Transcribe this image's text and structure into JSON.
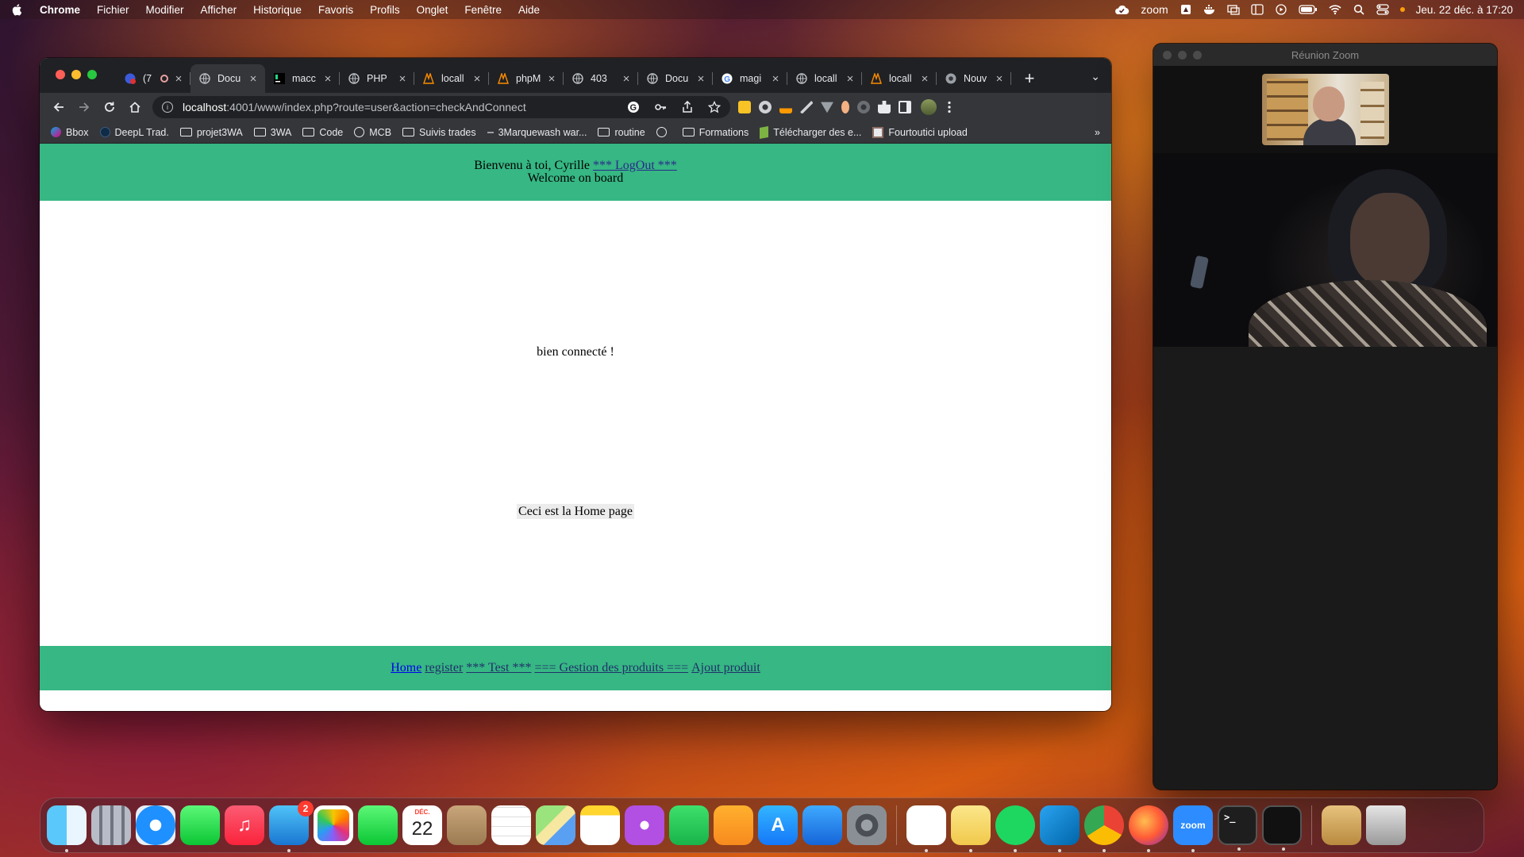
{
  "menubar": {
    "app_name": "Chrome",
    "menus": [
      "Fichier",
      "Modifier",
      "Afficher",
      "Historique",
      "Favoris",
      "Profils",
      "Onglet",
      "Fenêtre",
      "Aide"
    ],
    "right": {
      "zoom_label": "zoom",
      "datetime": "Jeu. 22 déc. à 17:20"
    }
  },
  "browser": {
    "tabs": [
      {
        "title": "(7",
        "icon": "notification-icon"
      },
      {
        "title": "Docu",
        "icon": "globe-icon",
        "active": true
      },
      {
        "title": "macc",
        "icon": "phpstorm-icon"
      },
      {
        "title": "PHP",
        "icon": "globe-icon"
      },
      {
        "title": "locall",
        "icon": "xampp-icon"
      },
      {
        "title": "phpM",
        "icon": "xampp-icon"
      },
      {
        "title": "403",
        "icon": "globe-icon"
      },
      {
        "title": "Docu",
        "icon": "globe-icon"
      },
      {
        "title": "magi",
        "icon": "google-icon"
      },
      {
        "title": "locall",
        "icon": "globe-icon"
      },
      {
        "title": "locall",
        "icon": "xampp-icon"
      },
      {
        "title": "Nouv",
        "icon": "chrome-icon"
      }
    ],
    "url_host": "localhost",
    "url_rest": ":4001/www/index.php?route=user&action=checkAndConnect",
    "bookmarks": [
      {
        "label": "Bbox",
        "icon": "bbox-icon"
      },
      {
        "label": "DeepL Trad.",
        "icon": "deepl-icon"
      },
      {
        "label": "projet3WA",
        "icon": "folder-icon"
      },
      {
        "label": "3WA",
        "icon": "folder-icon"
      },
      {
        "label": "Code",
        "icon": "folder-icon"
      },
      {
        "label": "MCB",
        "icon": "globe-icon"
      },
      {
        "label": "Suivis trades",
        "icon": "folder-icon"
      },
      {
        "label": "3Marquewash war...",
        "icon": "dash-icon"
      },
      {
        "label": "routine",
        "icon": "folder-icon"
      },
      {
        "label": "",
        "icon": "globe-icon"
      },
      {
        "label": "Formations",
        "icon": "folder-icon"
      },
      {
        "label": "Télécharger des e...",
        "icon": "book-icon"
      },
      {
        "label": "Fourtoutici upload",
        "icon": "upload-icon"
      }
    ],
    "bookmarks_more": "»"
  },
  "page": {
    "header_greeting": "Bienvenu à toi, Cyrille",
    "logout_link": "*** LogOut ***",
    "header_welcome": "Welcome on board",
    "message": "bien connecté !",
    "home_text": "Ceci est la Home page",
    "footer_links": [
      "Home",
      "register",
      "*** Test ***",
      "=== Gestion des produits ===",
      "Ajout produit"
    ],
    "colors": {
      "header_bg": "#36b783",
      "footer_bg": "#36b783"
    }
  },
  "zoom": {
    "window_title": "Réunion Zoom"
  },
  "dock": {
    "mail_badge": "2",
    "calendar_month": "DÉC.",
    "calendar_day": "22",
    "zoom_label": "zoom",
    "apps": [
      "Finder",
      "Launchpad",
      "Safari",
      "Messages",
      "Musique",
      "Mail",
      "Photos",
      "FaceTime",
      "Calendrier",
      "Contacts",
      "Rappels",
      "Plans",
      "Notes",
      "Podcasts",
      "Numbers",
      "Pages",
      "App Store",
      "Keynote",
      "Préférences Système",
      "Freeform",
      "Stickies",
      "Spotify",
      "Visual Studio Code",
      "Google Chrome",
      "Firefox",
      "zoom",
      "Terminal",
      "Moniteur d'activité",
      "Archives",
      "Corbeille"
    ]
  }
}
